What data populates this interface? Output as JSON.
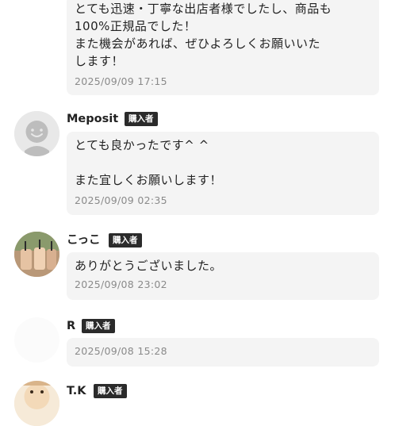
{
  "reviews": [
    {
      "message": "とても迅速・丁寧な出店者様でしたし、商品も\n100%正規品でした！\nまた機会があれば、ぜひよろしくお願いいた\nします！",
      "timestamp": "2025/09/09 17:15"
    },
    {
      "name": "Meposit",
      "badge": "購入者",
      "message": "とても良かったです^ ^\n\nまた宜しくお願いします！",
      "timestamp": "2025/09/09 02:35"
    },
    {
      "name": "こっこ",
      "badge": "購入者",
      "message": "ありがとうございました。",
      "timestamp": "2025/09/08 23:02"
    },
    {
      "name": "R",
      "badge": "購入者",
      "message": "",
      "timestamp": "2025/09/08 15:28"
    },
    {
      "name": "T.K",
      "badge": "購入者"
    }
  ]
}
